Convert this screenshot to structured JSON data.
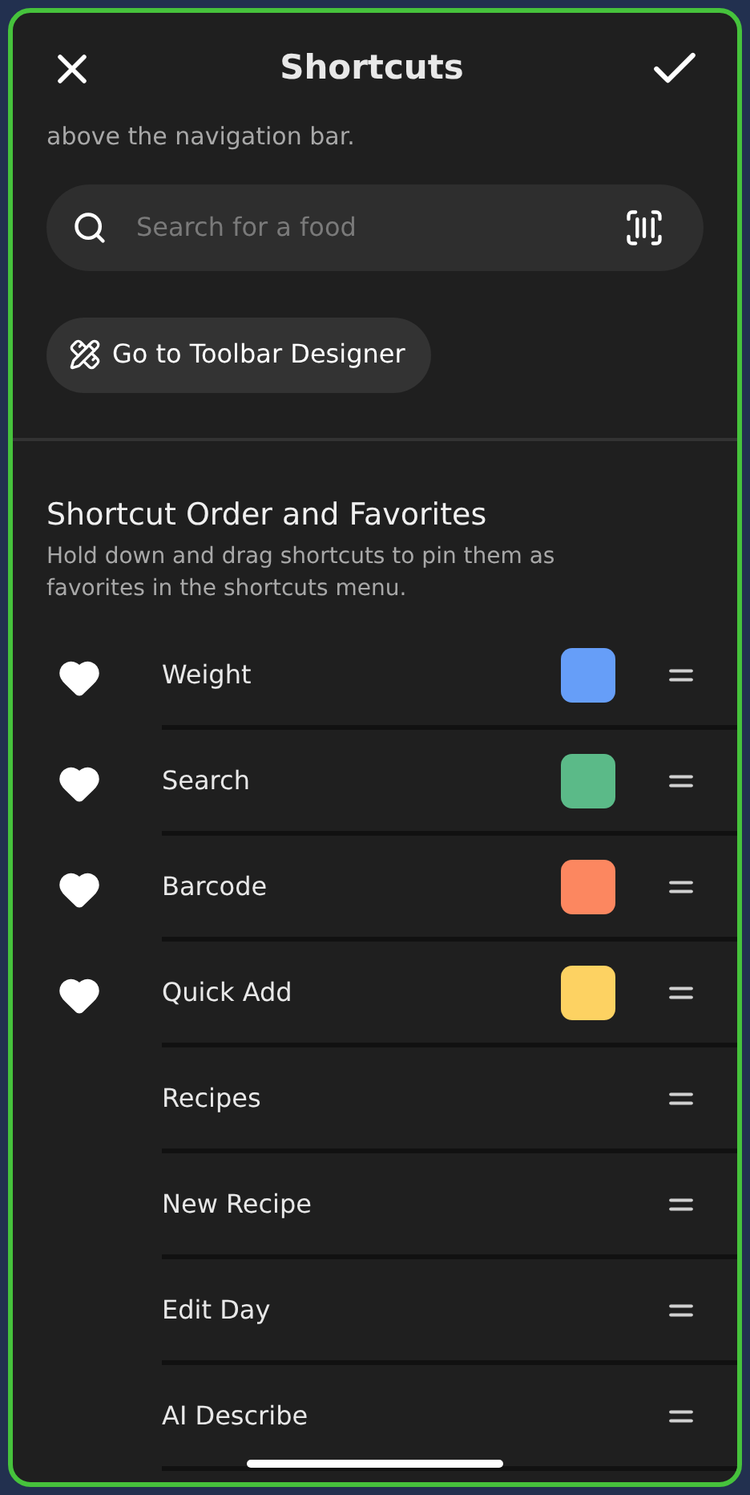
{
  "header": {
    "title": "Shortcuts"
  },
  "intro": "above the navigation bar.",
  "search": {
    "placeholder": "Search for a food"
  },
  "toolbar_button": "Go to Toolbar Designer",
  "section": {
    "title": "Shortcut Order and Favorites",
    "description": "Hold down and drag shortcuts to pin them as favorites in the shortcuts menu."
  },
  "shortcuts": [
    {
      "label": "Weight",
      "favorite": true,
      "color": "#669ef8"
    },
    {
      "label": "Search",
      "favorite": true,
      "color": "#5bba88"
    },
    {
      "label": "Barcode",
      "favorite": true,
      "color": "#fc8760"
    },
    {
      "label": "Quick Add",
      "favorite": true,
      "color": "#fdd262"
    },
    {
      "label": "Recipes",
      "favorite": false
    },
    {
      "label": "New Recipe",
      "favorite": false
    },
    {
      "label": "Edit Day",
      "favorite": false
    },
    {
      "label": "AI Describe",
      "favorite": false
    }
  ]
}
